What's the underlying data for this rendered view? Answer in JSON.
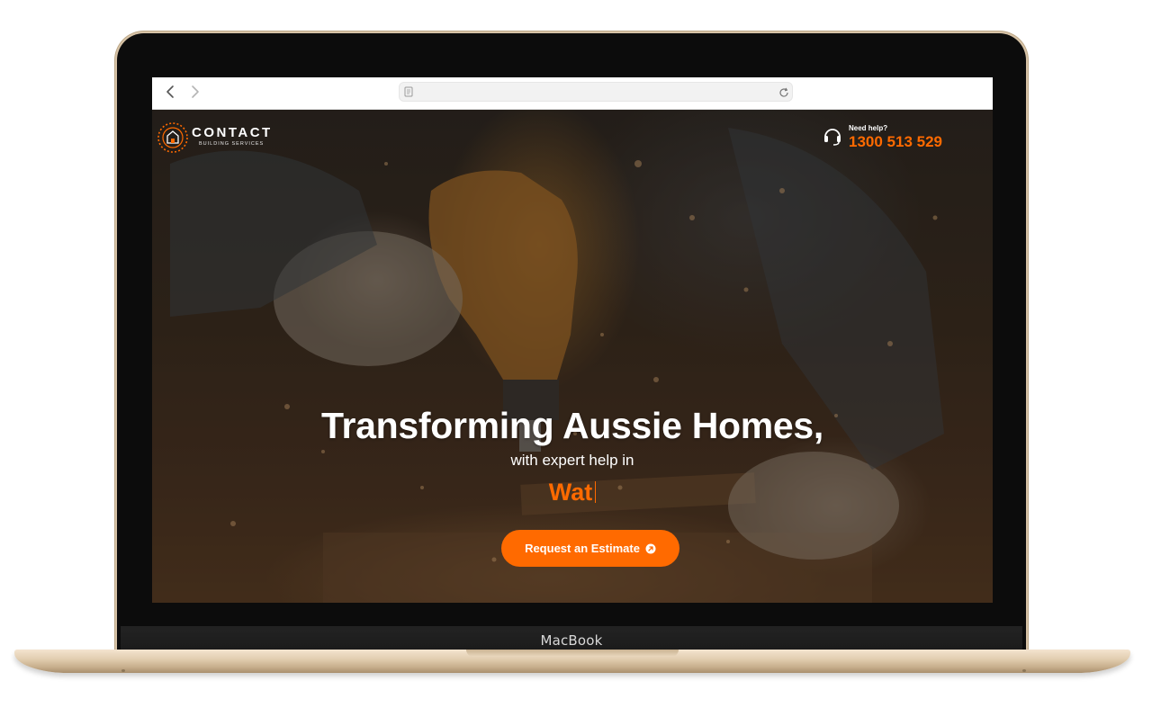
{
  "device": {
    "chin_label": "MacBook"
  },
  "browser": {
    "back_icon": "chevron-left-icon",
    "forward_icon": "chevron-right-icon",
    "address_value": "",
    "page_icon": "page-icon",
    "reload_icon": "reload-icon"
  },
  "site": {
    "logo": {
      "title": "CONTACT",
      "subtitle": "BUILDING SERVICES",
      "accent_color": "#ff6a00"
    },
    "help": {
      "label": "Need help?",
      "phone": "1300 513 529",
      "icon": "headset-icon"
    },
    "hero": {
      "headline": "Transforming Aussie Homes,",
      "subline": "with expert help in",
      "typed_text": "Wat",
      "cta_label": "Request an Estimate",
      "cta_icon": "arrow-up-right-circle-icon",
      "accent_color": "#ff6a00"
    }
  }
}
